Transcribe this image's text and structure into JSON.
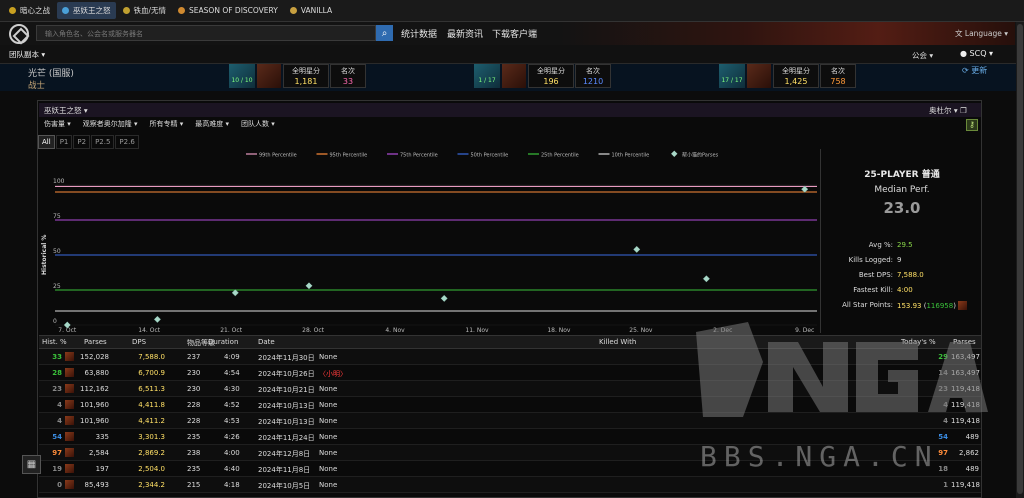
{
  "tabs": [
    {
      "label": "暗心之战",
      "color": "#c8a020"
    },
    {
      "label": "巫妖王之怒",
      "color": "#4aa0d8"
    },
    {
      "label": "铁血/无情",
      "color": "#c0a030"
    },
    {
      "label": "SEASON OF DISCOVERY",
      "color": "#d08a30"
    },
    {
      "label": "VANILLA",
      "color": "#c8a040"
    }
  ],
  "header": {
    "search_placeholder": "输入角色名、公会名或服务器名",
    "links": [
      "统计数据",
      "最新资讯",
      "下载客户端"
    ],
    "language": "Language"
  },
  "nav": {
    "raid": "团队副本",
    "guild": "公会",
    "user": "SCQ"
  },
  "character": {
    "name": "光芒 (国服)",
    "class": "战士",
    "update": "更新"
  },
  "bosses": [
    {
      "progress": "10 / 10",
      "label1": "全明星分",
      "value1": "1,181",
      "label2": "名次",
      "value2": "33",
      "color2": "#ff6bb0"
    },
    {
      "progress": "1 / 17",
      "label1": "全明星分",
      "value1": "196",
      "label2": "名次",
      "value2": "1210",
      "color2": "#5b8bff"
    },
    {
      "progress": "17 / 17",
      "label1": "全明星分",
      "value1": "1,425",
      "label2": "名次",
      "value2": "758",
      "color2": "#ff9a3a"
    }
  ],
  "panel": {
    "title": "巫妖王之怒",
    "right": "奥杜尔",
    "filters": [
      "伤害量",
      "观察者奥尔加隆",
      "所有专精",
      "最高难度",
      "团队人数"
    ],
    "phases": [
      "All",
      "P1",
      "P2",
      "P2.5",
      "P2.6"
    ]
  },
  "chart_data": {
    "type": "line",
    "ylabel": "Historical %",
    "yticks": [
      0,
      25,
      50,
      75,
      100
    ],
    "ylim": [
      0,
      110
    ],
    "x_labels": [
      "7. Oct",
      "14. Oct",
      "21. Oct",
      "28. Oct",
      "4. Nov",
      "11. Nov",
      "18. Nov",
      "25. Nov",
      "2. Dec",
      "9. Dec"
    ],
    "legend": [
      {
        "name": "99th Percentile",
        "color": "#e89bc0"
      },
      {
        "name": "95th Percentile",
        "color": "#ff8c3a"
      },
      {
        "name": "75th Percentile",
        "color": "#b04cd8"
      },
      {
        "name": "50th Percentile",
        "color": "#3a6be0"
      },
      {
        "name": "25th Percentile",
        "color": "#3ac03a"
      },
      {
        "name": "10th Percentile",
        "color": "#dddddd"
      },
      {
        "name": "帮小猫的Parses",
        "color": "#a8d8c8"
      }
    ],
    "percentile_lines": [
      99,
      95,
      75,
      50,
      25,
      10
    ],
    "points": [
      {
        "x": 0.0,
        "y": 0
      },
      {
        "x": 1.1,
        "y": 4
      },
      {
        "x": 2.05,
        "y": 23
      },
      {
        "x": 2.95,
        "y": 28
      },
      {
        "x": 4.6,
        "y": 19
      },
      {
        "x": 6.95,
        "y": 54
      },
      {
        "x": 7.8,
        "y": 33
      },
      {
        "x": 9.0,
        "y": 97
      }
    ],
    "xlim": [
      -0.15,
      9.15
    ]
  },
  "summary": {
    "title": "25-PLAYER 普通",
    "median_label": "Median Perf.",
    "median_value": "23.0",
    "rows": [
      {
        "k": "Avg %:",
        "v": "29.5",
        "c": "#8ad84a"
      },
      {
        "k": "Kills Logged:",
        "v": "9",
        "c": "#dddddd"
      },
      {
        "k": "Best DPS:",
        "v": "7,588.0",
        "c": "#ffe066"
      },
      {
        "k": "Fastest Kill:",
        "v": "4:00",
        "c": "#ffe066"
      },
      {
        "k": "All Star Points:",
        "v": "153.93",
        "v2": "116958",
        "c": "#ffe066"
      }
    ]
  },
  "table": {
    "headers": [
      "Hist. %",
      "Parses",
      "DPS",
      "物品等级",
      "Duration",
      "Date",
      "Killed With",
      "Today's %",
      "Parses"
    ],
    "rows": [
      {
        "hist": "33",
        "hist_color": "#3ac03a",
        "parses": "152,028",
        "dps": "7,588.0",
        "ilvl": "237",
        "dur": "4:09",
        "date": "2024年11月30日",
        "killed": "None",
        "killed_color": "#dddddd",
        "today": "29",
        "today_color": "#3ac03a",
        "parses2": "163,497"
      },
      {
        "hist": "28",
        "hist_color": "#3ac03a",
        "parses": "63,880",
        "dps": "6,700.9",
        "ilvl": "230",
        "dur": "4:54",
        "date": "2024年10月26日",
        "killed": "小明",
        "killed_color": "#ff3a3a",
        "today": "14",
        "today_color": "#888888",
        "parses2": "163,497"
      },
      {
        "hist": "23",
        "hist_color": "#888888",
        "parses": "112,162",
        "dps": "6,511.3",
        "ilvl": "230",
        "dur": "4:30",
        "date": "2024年10月21日",
        "killed": "None",
        "killed_color": "#dddddd",
        "today": "23",
        "today_color": "#888888",
        "parses2": "119,418"
      },
      {
        "hist": "4",
        "hist_color": "#888888",
        "parses": "101,960",
        "dps": "4,411.8",
        "ilvl": "228",
        "dur": "4:52",
        "date": "2024年10月13日",
        "killed": "None",
        "killed_color": "#dddddd",
        "today": "4",
        "today_color": "#888888",
        "parses2": "119,418"
      },
      {
        "hist": "4",
        "hist_color": "#888888",
        "parses": "101,960",
        "dps": "4,411.2",
        "ilvl": "228",
        "dur": "4:53",
        "date": "2024年10月13日",
        "killed": "None",
        "killed_color": "#dddddd",
        "today": "4",
        "today_color": "#888888",
        "parses2": "119,418"
      },
      {
        "hist": "54",
        "hist_color": "#3a8be0",
        "parses": "335",
        "dps": "3,301.3",
        "ilvl": "235",
        "dur": "4:26",
        "date": "2024年11月24日",
        "killed": "None",
        "killed_color": "#dddddd",
        "today": "54",
        "today_color": "#3a8be0",
        "parses2": "489"
      },
      {
        "hist": "97",
        "hist_color": "#ff8c3a",
        "parses": "2,584",
        "dps": "2,869.2",
        "ilvl": "238",
        "dur": "4:00",
        "date": "2024年12月8日",
        "killed": "None",
        "killed_color": "#dddddd",
        "today": "97",
        "today_color": "#ff8c3a",
        "parses2": "2,862"
      },
      {
        "hist": "19",
        "hist_color": "#888888",
        "parses": "197",
        "dps": "2,504.0",
        "ilvl": "235",
        "dur": "4:40",
        "date": "2024年11月8日",
        "killed": "None",
        "killed_color": "#dddddd",
        "today": "18",
        "today_color": "#888888",
        "parses2": "489"
      },
      {
        "hist": "0",
        "hist_color": "#888888",
        "parses": "85,493",
        "dps": "2,344.2",
        "ilvl": "215",
        "dur": "4:18",
        "date": "2024年10月5日",
        "killed": "None",
        "killed_color": "#dddddd",
        "today": "1",
        "today_color": "#888888",
        "parses2": "119,418"
      }
    ]
  },
  "watermark": "BBS.NGA.CN"
}
